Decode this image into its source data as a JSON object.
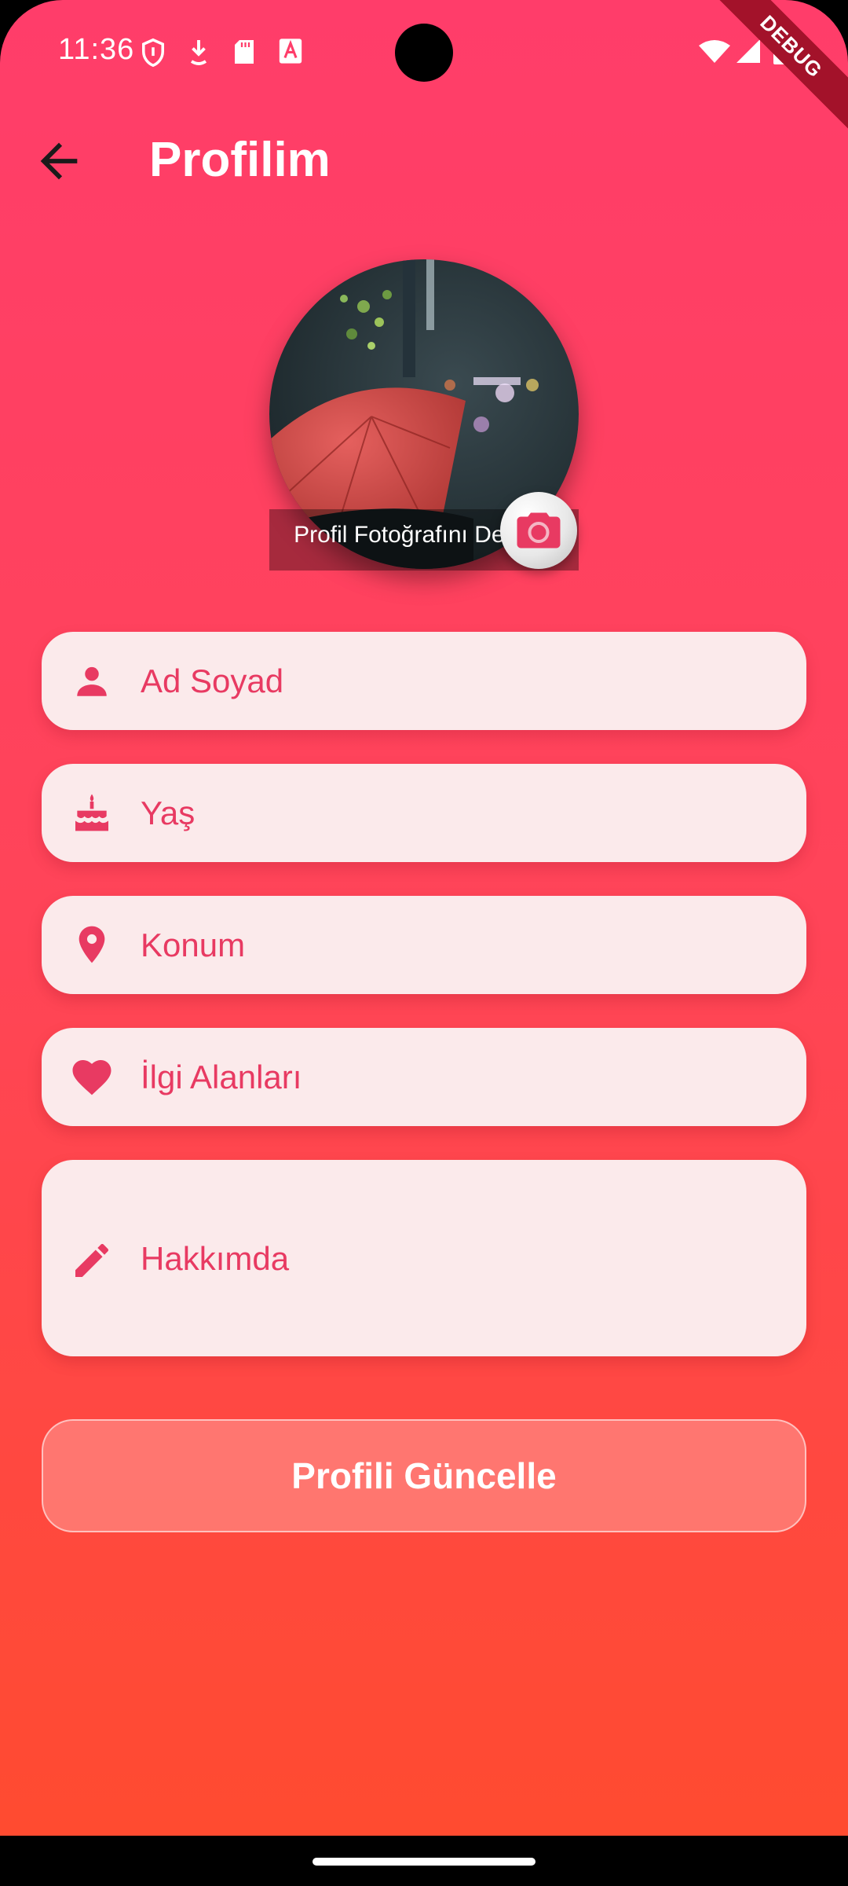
{
  "status_bar": {
    "time": "11:36",
    "debug_label": "DEBUG",
    "icons": [
      "shield-icon",
      "download-icon",
      "sd-card-icon",
      "text-a-icon",
      "wifi-icon",
      "signal-icon",
      "battery-icon"
    ]
  },
  "app_bar": {
    "title": "Profilim",
    "back_icon": "arrow-left-icon"
  },
  "avatar": {
    "change_photo_label": "Profil Fotoğrafını Değiştir",
    "camera_icon": "camera-icon"
  },
  "form": {
    "name_placeholder": "Ad Soyad",
    "age_placeholder": "Yaş",
    "location_placeholder": "Konum",
    "interests_placeholder": "İlgi Alanları",
    "about_placeholder": "Hakkımda"
  },
  "actions": {
    "update_label": "Profili Güncelle"
  },
  "colors": {
    "gradient_top": "#ff3d6a",
    "gradient_bottom": "#ff4b30",
    "field_bg": "#fbeaeb",
    "accent": "#e83a62"
  }
}
